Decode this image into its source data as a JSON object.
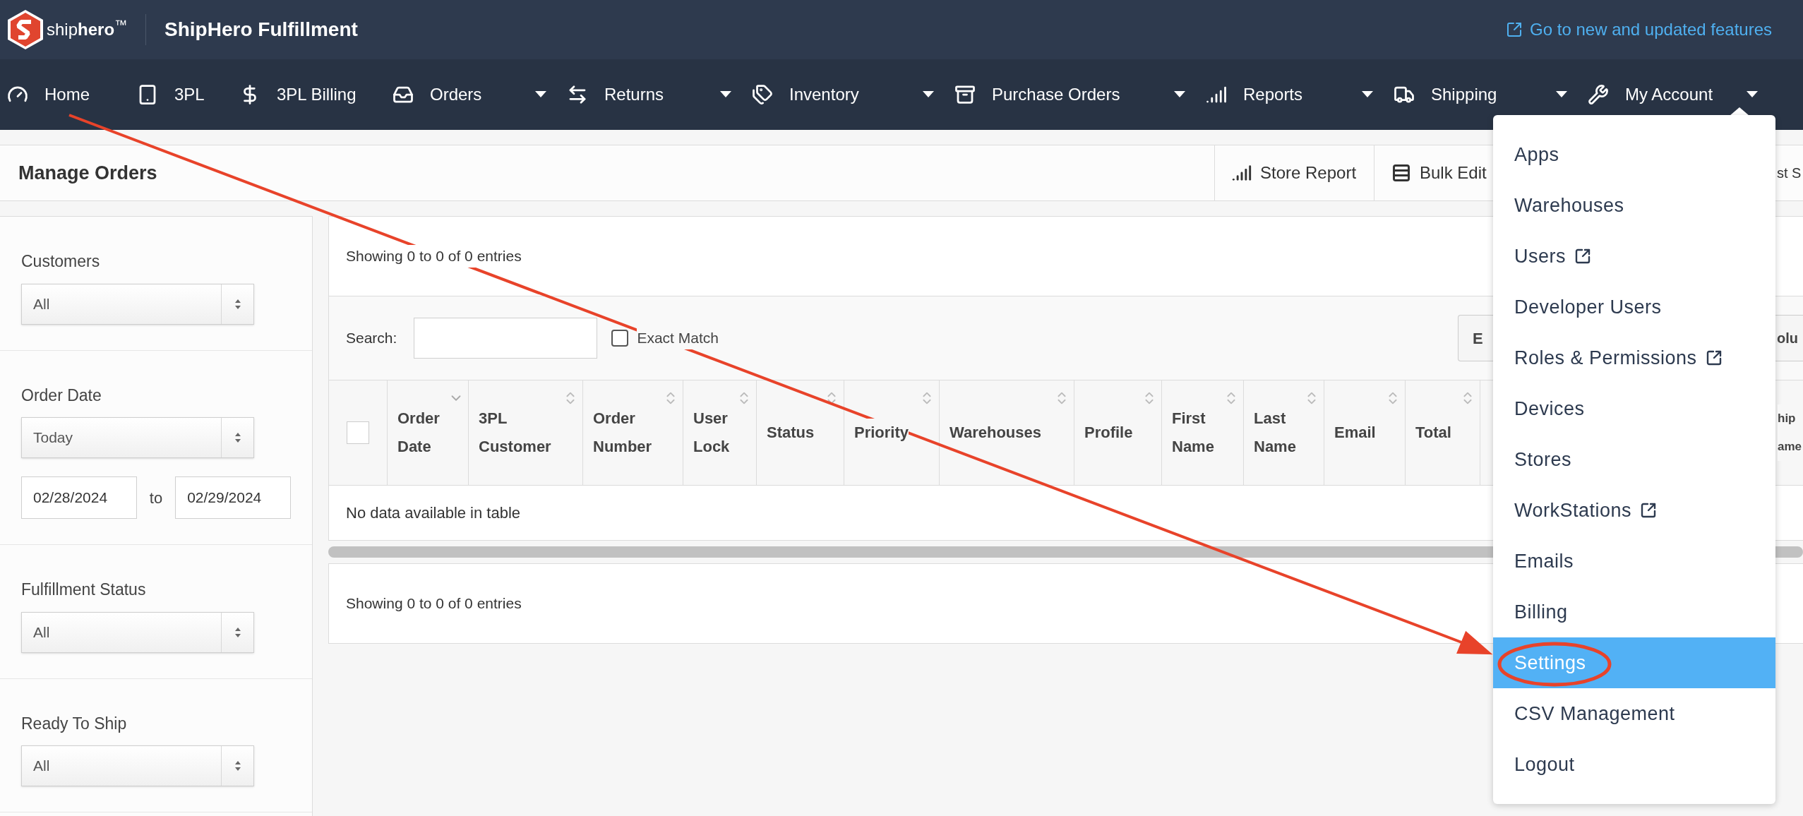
{
  "brand": {
    "logo_text": "ship**hero**$^{™}$",
    "app_title": "ShipHero Fulfillment"
  },
  "new_features_link": "Go to new and updated features",
  "nav": [
    {
      "label": "Home",
      "has_menu": false
    },
    {
      "label": "3PL",
      "has_menu": false
    },
    {
      "label": "3PL Billing",
      "has_menu": false
    },
    {
      "label": "Orders",
      "has_menu": true
    },
    {
      "label": "Returns",
      "has_menu": true
    },
    {
      "label": "Inventory",
      "has_menu": true
    },
    {
      "label": "Purchase Orders",
      "has_menu": true
    },
    {
      "label": "Reports",
      "has_menu": true
    },
    {
      "label": "Shipping",
      "has_menu": true
    },
    {
      "label": "My Account",
      "has_menu": true
    }
  ],
  "page_title": "Manage Orders",
  "page_actions": [
    "Store Report",
    "Bulk Edit",
    "st S"
  ],
  "filters": [
    {
      "label": "Customers",
      "kind": "select",
      "value": "All"
    },
    {
      "label": "Order Date",
      "kind": "date_range",
      "value": "Today",
      "from": "02/28/2024",
      "to_label": "to",
      "to": "02/29/2024"
    },
    {
      "label": "Fulfillment Status",
      "kind": "select",
      "value": "All"
    },
    {
      "label": "Ready To Ship",
      "kind": "select",
      "value": "All"
    }
  ],
  "info_top": "Showing 0 to 0 of 0 entries",
  "search": {
    "label": "Search:",
    "exact_match": {
      "label": "Exact Match",
      "checked": false
    }
  },
  "table_buttons": [
    "E",
    "olu"
  ],
  "table": {
    "select_all_checked": false,
    "columns": [
      {
        "lines": [
          "Order",
          "Date"
        ],
        "sorted": true,
        "kind": "full"
      },
      {
        "lines": [
          "3PL",
          "Customer"
        ],
        "sorted": false,
        "kind": "full"
      },
      {
        "lines": [
          "Order",
          "Number"
        ],
        "sorted": false,
        "kind": "full"
      },
      {
        "lines": [
          "User",
          "Lock"
        ],
        "sorted": false,
        "kind": "full"
      },
      {
        "lines": [
          "Status"
        ],
        "sorted": false,
        "kind": "full"
      },
      {
        "lines": [
          "Priority"
        ],
        "sorted": false,
        "kind": "full"
      },
      {
        "lines": [
          "Warehouses"
        ],
        "sorted": false,
        "kind": "full"
      },
      {
        "lines": [
          "Profile"
        ],
        "sorted": false,
        "kind": "full"
      },
      {
        "lines": [
          "First",
          "Name"
        ],
        "sorted": false,
        "kind": "full"
      },
      {
        "lines": [
          "Last",
          "Name"
        ],
        "sorted": false,
        "kind": "full"
      },
      {
        "lines": [
          "Email"
        ],
        "sorted": false,
        "kind": "full"
      },
      {
        "lines": [
          "Total"
        ],
        "sorted": false,
        "kind": "full"
      },
      {
        "lines": [
          "hip",
          "ame"
        ],
        "kind": "clipped"
      }
    ],
    "empty_message": "No data available in table"
  },
  "info_bottom": "Showing 0 to 0 of 0 entries",
  "account_menu": [
    {
      "label": "Apps",
      "external": false,
      "selected": false
    },
    {
      "label": "Warehouses",
      "external": false,
      "selected": false
    },
    {
      "label": "Users",
      "external": true,
      "selected": false
    },
    {
      "label": "Developer Users",
      "external": false,
      "selected": false
    },
    {
      "label": "Roles & Permissions",
      "external": true,
      "selected": false
    },
    {
      "label": "Devices",
      "external": false,
      "selected": false
    },
    {
      "label": "Stores",
      "external": false,
      "selected": false
    },
    {
      "label": "WorkStations",
      "external": true,
      "selected": false
    },
    {
      "label": "Emails",
      "external": false,
      "selected": false
    },
    {
      "label": "Billing",
      "external": false,
      "selected": false
    },
    {
      "label": "Settings",
      "external": false,
      "selected": true
    },
    {
      "label": "CSV Management",
      "external": false,
      "selected": false
    },
    {
      "label": "Logout",
      "external": false,
      "selected": false
    }
  ]
}
